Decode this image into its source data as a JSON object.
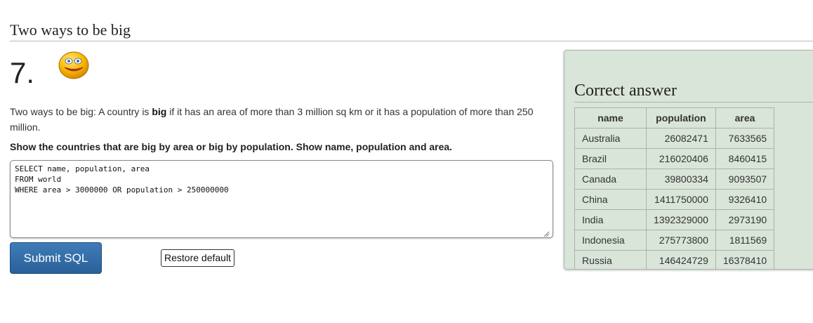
{
  "section_title": "Two ways to be big",
  "question": {
    "number": "7.",
    "description_prefix": "Two ways to be big: A country is ",
    "description_bold": "big",
    "description_suffix": " if it has an area of more than 3 million sq km or it has a population of more than 250 million.",
    "task": "Show the countries that are big by area or big by population. Show name, population and area."
  },
  "editor": {
    "sql": "SELECT name, population, area\nFROM world\nWHERE area > 3000000 OR population > 250000000"
  },
  "buttons": {
    "submit_label": "Submit SQL",
    "restore_label": "Restore default"
  },
  "answer": {
    "title": "Correct answer",
    "columns": [
      "name",
      "population",
      "area"
    ],
    "rows": [
      {
        "name": "Australia",
        "population": "26082471",
        "area": "7633565"
      },
      {
        "name": "Brazil",
        "population": "216020406",
        "area": "8460415"
      },
      {
        "name": "Canada",
        "population": "39800334",
        "area": "9093507"
      },
      {
        "name": "China",
        "population": "1411750000",
        "area": "9326410"
      },
      {
        "name": "India",
        "population": "1392329000",
        "area": "2973190"
      },
      {
        "name": "Indonesia",
        "population": "275773800",
        "area": "1811569"
      },
      {
        "name": "Russia",
        "population": "146424729",
        "area": "16378410"
      }
    ]
  },
  "icons": {
    "smiley": "smiley-face-icon"
  }
}
